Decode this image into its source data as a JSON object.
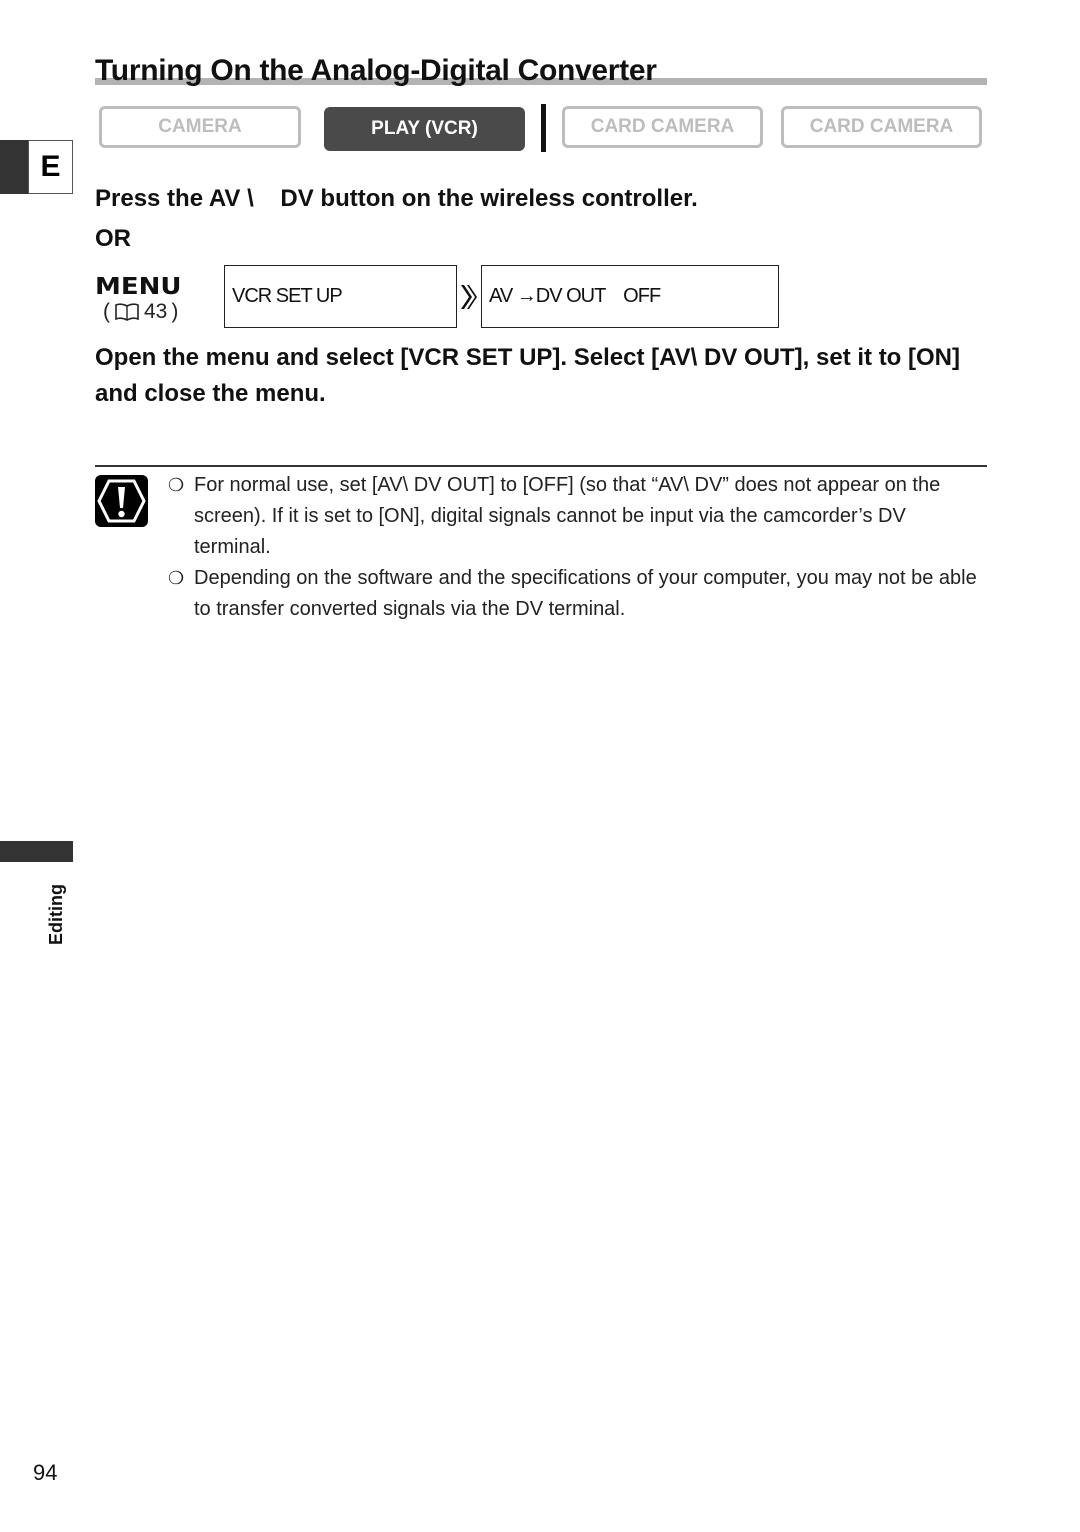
{
  "page": {
    "title": "Turning On the Analog-Digital Converter",
    "language_tab": "E",
    "side_section_label": "Editing",
    "page_number": "94"
  },
  "mode_buttons": [
    {
      "label": "CAMERA",
      "active": false
    },
    {
      "label": "PLAY (VCR)",
      "active": true
    },
    {
      "label": "CARD CAMERA",
      "active": false
    },
    {
      "label": "CARD CAMERA",
      "active": false
    }
  ],
  "steps": {
    "step1": "Press the AV \\    DV button on the wireless controller.",
    "or": "OR",
    "menu_label": "MENU",
    "menu_ref": "43",
    "menu_box1": "VCR SET UP",
    "menu_box2": "AV →DV OUT    OFF",
    "step2": "Open the menu and select [VCR SET UP]. Select [AV\\   DV OUT], set it to [ON] and close the menu."
  },
  "notes": [
    {
      "bullet": "❍",
      "text": "For normal use, set [AV\\   DV OUT] to [OFF] (so that “AV\\   DV” does not appear on the screen). If it is set to [ON], digital signals cannot be input via the camcorder’s DV terminal."
    },
    {
      "bullet": "❍",
      "text": "Depending on the software and the specifications of your computer, you may not be able to transfer converted signals via the DV terminal."
    }
  ],
  "colors": {
    "active_mode": "#4a4a4a",
    "inactive_mode": "#bdbdbd",
    "title_bar": "#b3b3b3"
  }
}
